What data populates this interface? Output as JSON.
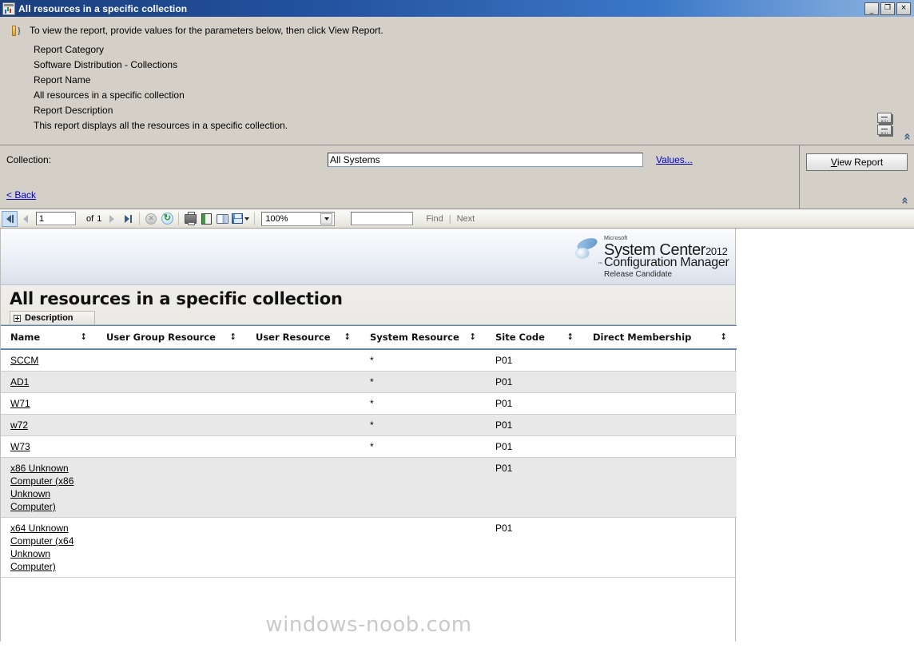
{
  "window": {
    "title": "All resources in a specific collection",
    "icon": "report-icon",
    "minimize_label": "_",
    "restore_label": "❐",
    "close_label": "×"
  },
  "info": {
    "lead": "To view the report, provide values for the parameters below, then click View Report.",
    "category_label": "Report Category",
    "category_value": "Software Distribution - Collections",
    "name_label": "Report Name",
    "name_value": "All resources in a specific collection",
    "description_label": "Report Description",
    "description_value": "This report displays all the resources in a specific collection.",
    "collapse_chevron": "«"
  },
  "parameters": {
    "collection_label": "Collection:",
    "collection_value": "All Systems",
    "collection_placeholder": "",
    "values_link": "Values...",
    "back_link": "< Back",
    "view_report_accel": "V",
    "view_report_rest": "iew Report",
    "collapse_chevron": "«"
  },
  "toolbar": {
    "first_page": "first-page",
    "prev_page": "previous-page",
    "page_number": "1",
    "of_label": "of",
    "page_count": "1",
    "next_page": "next-page",
    "last_page": "last-page",
    "stop_label": "✕",
    "refresh_label": "↻",
    "zoom_value": "100%",
    "find_value": "",
    "find_label": "Find",
    "find_separator": "|",
    "next_label": "Next"
  },
  "report": {
    "logo": {
      "microsoft": "Microsoft",
      "line1": "System Center",
      "year": "2012",
      "line2": "Configuration Manager",
      "line3": "Release Candidate",
      "tm": "™"
    },
    "title": "All resources in a specific collection",
    "description_tab": "Description",
    "columns": [
      "Name",
      "User Group Resource",
      "User Resource",
      "System Resource",
      "Site Code",
      "Direct Membership"
    ],
    "sort_glyph": "↕",
    "rows": [
      {
        "name": "SCCM",
        "user_group_resource": "",
        "user_resource": "",
        "system_resource": "*",
        "site_code": "P01",
        "direct_membership": ""
      },
      {
        "name": "AD1",
        "user_group_resource": "",
        "user_resource": "",
        "system_resource": "*",
        "site_code": "P01",
        "direct_membership": ""
      },
      {
        "name": "W71",
        "user_group_resource": "",
        "user_resource": "",
        "system_resource": "*",
        "site_code": "P01",
        "direct_membership": ""
      },
      {
        "name": "w72",
        "user_group_resource": "",
        "user_resource": "",
        "system_resource": "*",
        "site_code": "P01",
        "direct_membership": ""
      },
      {
        "name": "W73",
        "user_group_resource": "",
        "user_resource": "",
        "system_resource": "*",
        "site_code": "P01",
        "direct_membership": ""
      },
      {
        "name": "x86 Unknown Computer (x86 Unknown Computer)",
        "user_group_resource": "",
        "user_resource": "",
        "system_resource": "",
        "site_code": "P01",
        "direct_membership": ""
      },
      {
        "name": "x64 Unknown Computer (x64 Unknown Computer)",
        "user_group_resource": "",
        "user_resource": "",
        "system_resource": "",
        "site_code": "P01",
        "direct_membership": ""
      }
    ],
    "watermark": "windows-noob.com"
  },
  "colors": {
    "titlebar_start": "#1b3f7d",
    "titlebar_end": "#8fb5e0",
    "dialog_face": "#d4d0c8",
    "link": "#0000cc",
    "table_rule": "#5f82b5",
    "alt_row": "#e8e8e8",
    "watermark": "#c9c9c9"
  }
}
